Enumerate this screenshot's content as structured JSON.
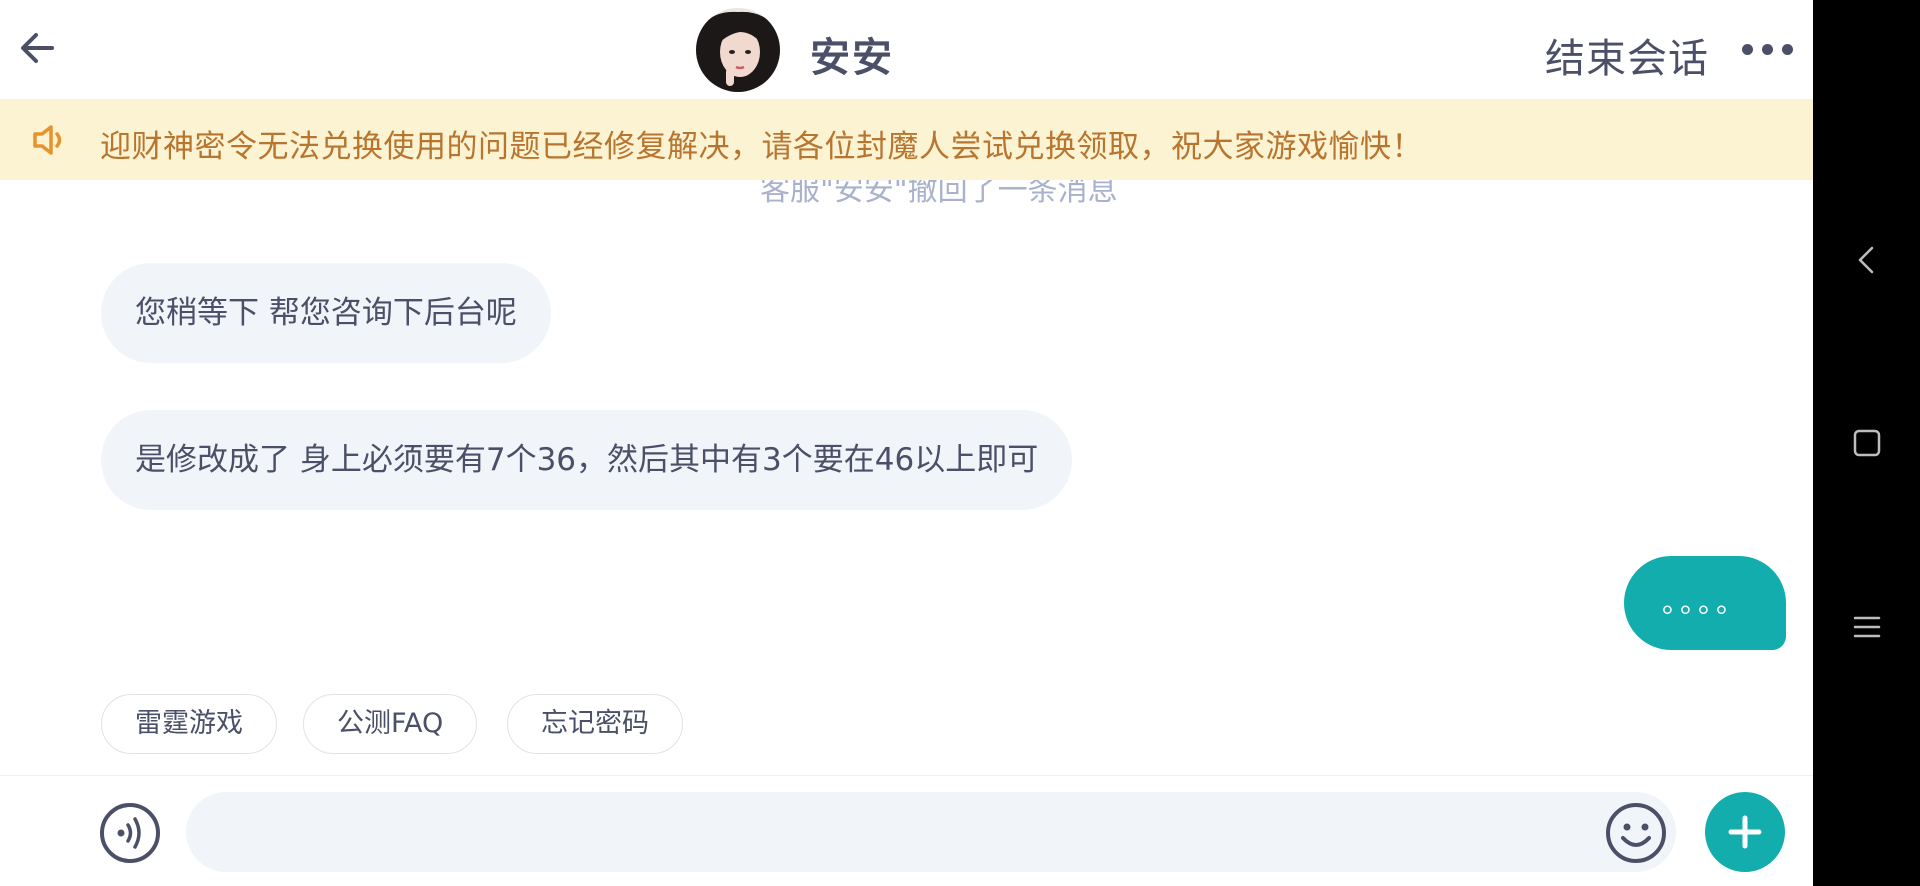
{
  "header": {
    "title": "安安",
    "end_label": "结束会话"
  },
  "notice": {
    "text": "迎财神密令无法兑换使用的问题已经修复解决，请各位封魔人尝试兑换领取，祝大家游戏愉快！"
  },
  "faded_system_line": "客服\"安安\"撤回了一条消息",
  "messages": [
    {
      "side": "left",
      "text": "您稍等下 帮您咨询下后台呢"
    },
    {
      "side": "left",
      "text": "是修改成了 身上必须要有7个36，然后其中有3个要在46以上即可"
    },
    {
      "side": "right",
      "text": "。。。。"
    }
  ],
  "quick_replies": [
    "雷霆游戏",
    "公测FAQ",
    "忘记密码"
  ],
  "input": {
    "value": "",
    "placeholder": ""
  },
  "colors": {
    "accent": "#14adad",
    "notice_bg": "#fbf3d2",
    "notice_text": "#b87530",
    "bubble_bg": "#f1f4f8",
    "text": "#4b5068"
  },
  "icons": {
    "back": "arrow-left-icon",
    "more": "ellipsis-icon",
    "notice": "speaker-icon",
    "voice": "voice-icon",
    "emoji": "smiley-icon",
    "plus": "plus-icon",
    "nav_back": "chevron-left-icon",
    "nav_home": "square-icon",
    "nav_menu": "menu-icon"
  }
}
